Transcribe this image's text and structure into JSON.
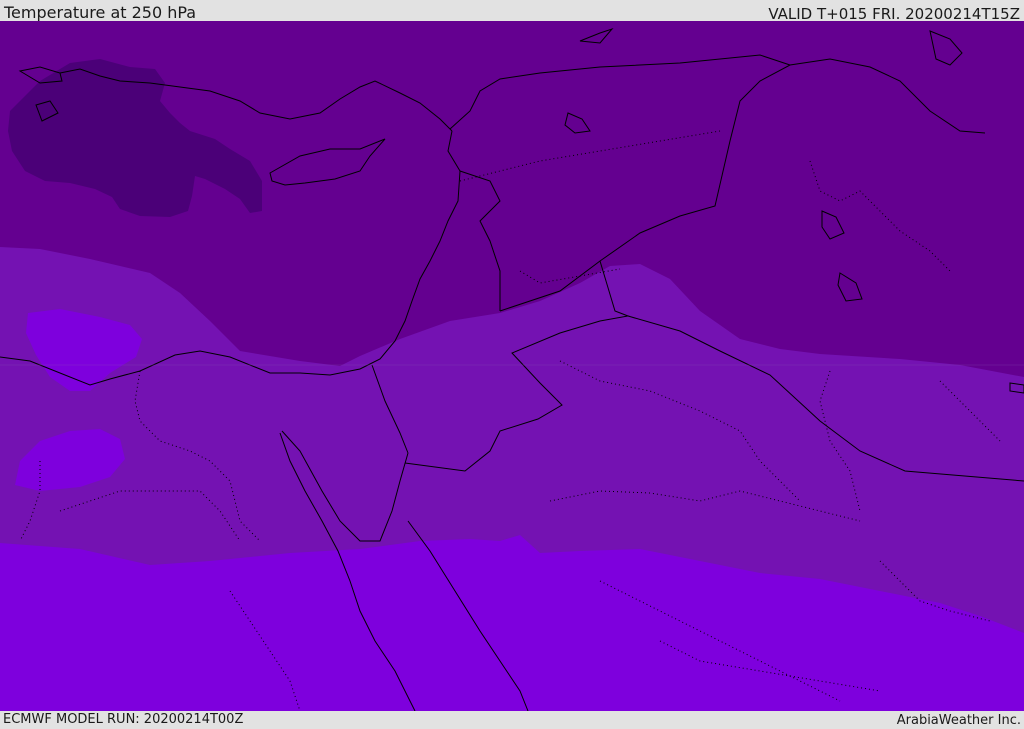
{
  "header": {
    "title": "Temperature at 250 hPa",
    "valid": "VALID T+015 FRI. 20200214T15Z"
  },
  "footer": {
    "model_run": "ECMWF MODEL RUN: 20200214T00Z",
    "credit": "ArabiaWeather Inc."
  },
  "map": {
    "colors": {
      "coldest": "#4b0078",
      "cold": "#640090",
      "mid": "#7412b2",
      "warm": "#7e00dd",
      "coastline": "#000000",
      "border": "#000000"
    }
  }
}
